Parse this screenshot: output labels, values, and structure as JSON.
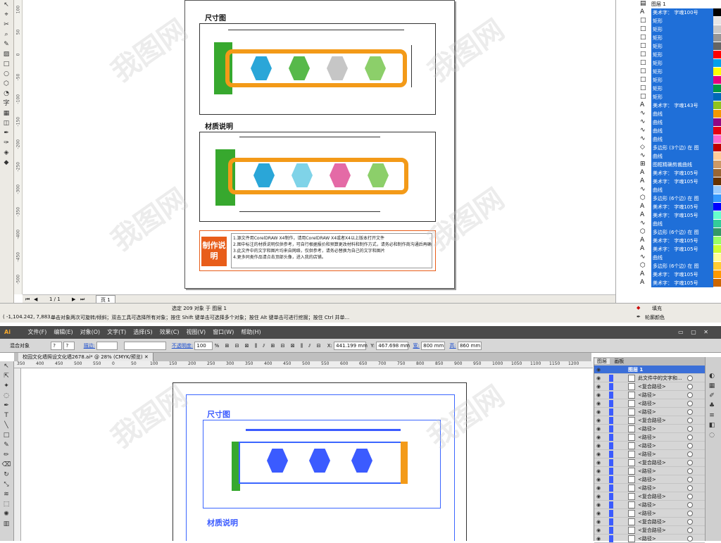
{
  "coreldraw": {
    "page": {
      "section1_title": "尺寸图",
      "section2_title": "材质说明",
      "note_badge": "制作说明",
      "notes": [
        "1.源文件用CorelDRAW X4制作，请用CorelDRAW X4或者X4以上版本打开文件",
        "2.图中标注的材质说明仅供参考，可自行根据报价和预算更改材料和制作方式，请务必和制作商沟通后再确定下单",
        "3.此文件中的文字和图片均来自网络，仅供参考，请务必替换为自己的文字和图片",
        "4.更多同类作品请点击顶部头像，进入我的店铺。"
      ]
    },
    "page_nav": {
      "counter": "1 / 1",
      "page_tab": "页 1"
    },
    "status": {
      "selection": "选定 209 对象 于 图层 1",
      "coords": "( -1,104.242, 7,883.... ",
      "hint": "单击对象两次可旋转/倾斜；双击工具可选择所有对象；按住 Shift 键单击可选择多个对象；按住 Alt 键单击可进行挖掘；按住 Ctrl 并单...",
      "fill_label": "填充",
      "outline_label": "轮廓颜色"
    },
    "object_manager": {
      "header": "图层 1",
      "rows": [
        {
          "icon": "A",
          "label": "美术字：  字魂100号"
        },
        {
          "icon": "□",
          "label": "矩形"
        },
        {
          "icon": "□",
          "label": "矩形"
        },
        {
          "icon": "□",
          "label": "矩形"
        },
        {
          "icon": "□",
          "label": "矩形"
        },
        {
          "icon": "□",
          "label": "矩形"
        },
        {
          "icon": "□",
          "label": "矩形"
        },
        {
          "icon": "□",
          "label": "矩形"
        },
        {
          "icon": "□",
          "label": "矩形"
        },
        {
          "icon": "□",
          "label": "矩形"
        },
        {
          "icon": "□",
          "label": "矩形"
        },
        {
          "icon": "A",
          "label": "美术字：  字魂143号"
        },
        {
          "icon": "∿",
          "label": "曲线"
        },
        {
          "icon": "∿",
          "label": "曲线"
        },
        {
          "icon": "∿",
          "label": "曲线"
        },
        {
          "icon": "∿",
          "label": "曲线"
        },
        {
          "icon": "◇",
          "label": "多边形 (3个边) 在 图"
        },
        {
          "icon": "∿",
          "label": "曲线"
        },
        {
          "icon": "⊞",
          "label": "图框精确剪裁曲线"
        },
        {
          "icon": "A",
          "label": "美术字：  字魂105号"
        },
        {
          "icon": "A",
          "label": "美术字：  字魂105号"
        },
        {
          "icon": "∿",
          "label": "曲线"
        },
        {
          "icon": "⬡",
          "label": "多边形 (6个边) 在 图"
        },
        {
          "icon": "A",
          "label": "美术字：  字魂105号"
        },
        {
          "icon": "A",
          "label": "美术字：  字魂105号"
        },
        {
          "icon": "∿",
          "label": "曲线"
        },
        {
          "icon": "⬡",
          "label": "多边形 (6个边) 在 图"
        },
        {
          "icon": "A",
          "label": "美术字：  字魂105号"
        },
        {
          "icon": "A",
          "label": "美术字：  字魂105号"
        },
        {
          "icon": "∿",
          "label": "曲线"
        },
        {
          "icon": "⬡",
          "label": "多边形 (6个边) 在 图"
        },
        {
          "icon": "A",
          "label": "美术字：  字魂105号"
        },
        {
          "icon": "A",
          "label": "美术字：  字魂105号"
        }
      ]
    },
    "palette": [
      "#ffffff",
      "#000000",
      "#e6e6e6",
      "#c8c8c8",
      "#969696",
      "#646464",
      "#ff0000",
      "#00a0e9",
      "#ffff00",
      "#e4007f",
      "#009944",
      "#0068b7",
      "#8fc31f",
      "#f39800",
      "#920783",
      "#e60012",
      "#ff66cc",
      "#c00000",
      "#ffcc99",
      "#cc9966",
      "#996633",
      "#663300",
      "#99ccff",
      "#3399ff",
      "#0000ff",
      "#66ffcc",
      "#33cc99",
      "#339966",
      "#99ff66",
      "#ccff33",
      "#ffff99",
      "#ffcc33",
      "#ff9900",
      "#cc6600"
    ],
    "vruler_ticks": [
      "100",
      "50",
      "0",
      "-50",
      "-100",
      "-150",
      "-200",
      "-250",
      "-300",
      "-350",
      "-400",
      "-450",
      "-500"
    ]
  },
  "illustrator": {
    "app_logo": "Ai",
    "menus": [
      "文件(F)",
      "编辑(E)",
      "对象(O)",
      "文字(T)",
      "选择(S)",
      "效果(C)",
      "视图(V)",
      "窗口(W)",
      "帮助(H)"
    ],
    "control": {
      "mode": "混合对象",
      "stroke_label": "描边:",
      "opacity_label": "不透明度:",
      "opacity_value": "100",
      "opacity_unit": "%",
      "x_label": "X:",
      "x_value": "441.199 mm",
      "y_label": "Y:",
      "y_value": "467.698 mm",
      "w_label": "宽:",
      "w_value": "800 mm",
      "h_label": "高:",
      "h_value": "860 mm"
    },
    "doc_tab": "校园文化墙照设文化墙2678.ai* @ 28% (CMYK/预览)",
    "hruler_ticks": [
      "350",
      "400",
      "450",
      "500",
      "550",
      "0",
      "50",
      "100",
      "150",
      "200",
      "250",
      "300",
      "350",
      "400",
      "450",
      "500",
      "550",
      "600",
      "650",
      "700",
      "750",
      "800",
      "850",
      "900",
      "950",
      "1000",
      "1050",
      "1100",
      "1150",
      "1200"
    ],
    "artboard": {
      "section1_title": "尺寸图",
      "section2_title": "材质说明"
    },
    "layers_panel": {
      "tabs": [
        "图层",
        "画板"
      ],
      "layer_name": "图层 1",
      "rows": [
        "此文件中的文字和...",
        "<复合路径>",
        "<路径>",
        "<路径>",
        "<路径>",
        "<复合路径>",
        "<路径>",
        "<路径>",
        "<路径>",
        "<路径>",
        "<复合路径>",
        "<路径>",
        "<路径>",
        "<路径>",
        "<复合路径>",
        "<路径>",
        "<路径>",
        "<复合路径>",
        "<复合路径>",
        "<路径>"
      ]
    }
  },
  "watermark": "我图网"
}
